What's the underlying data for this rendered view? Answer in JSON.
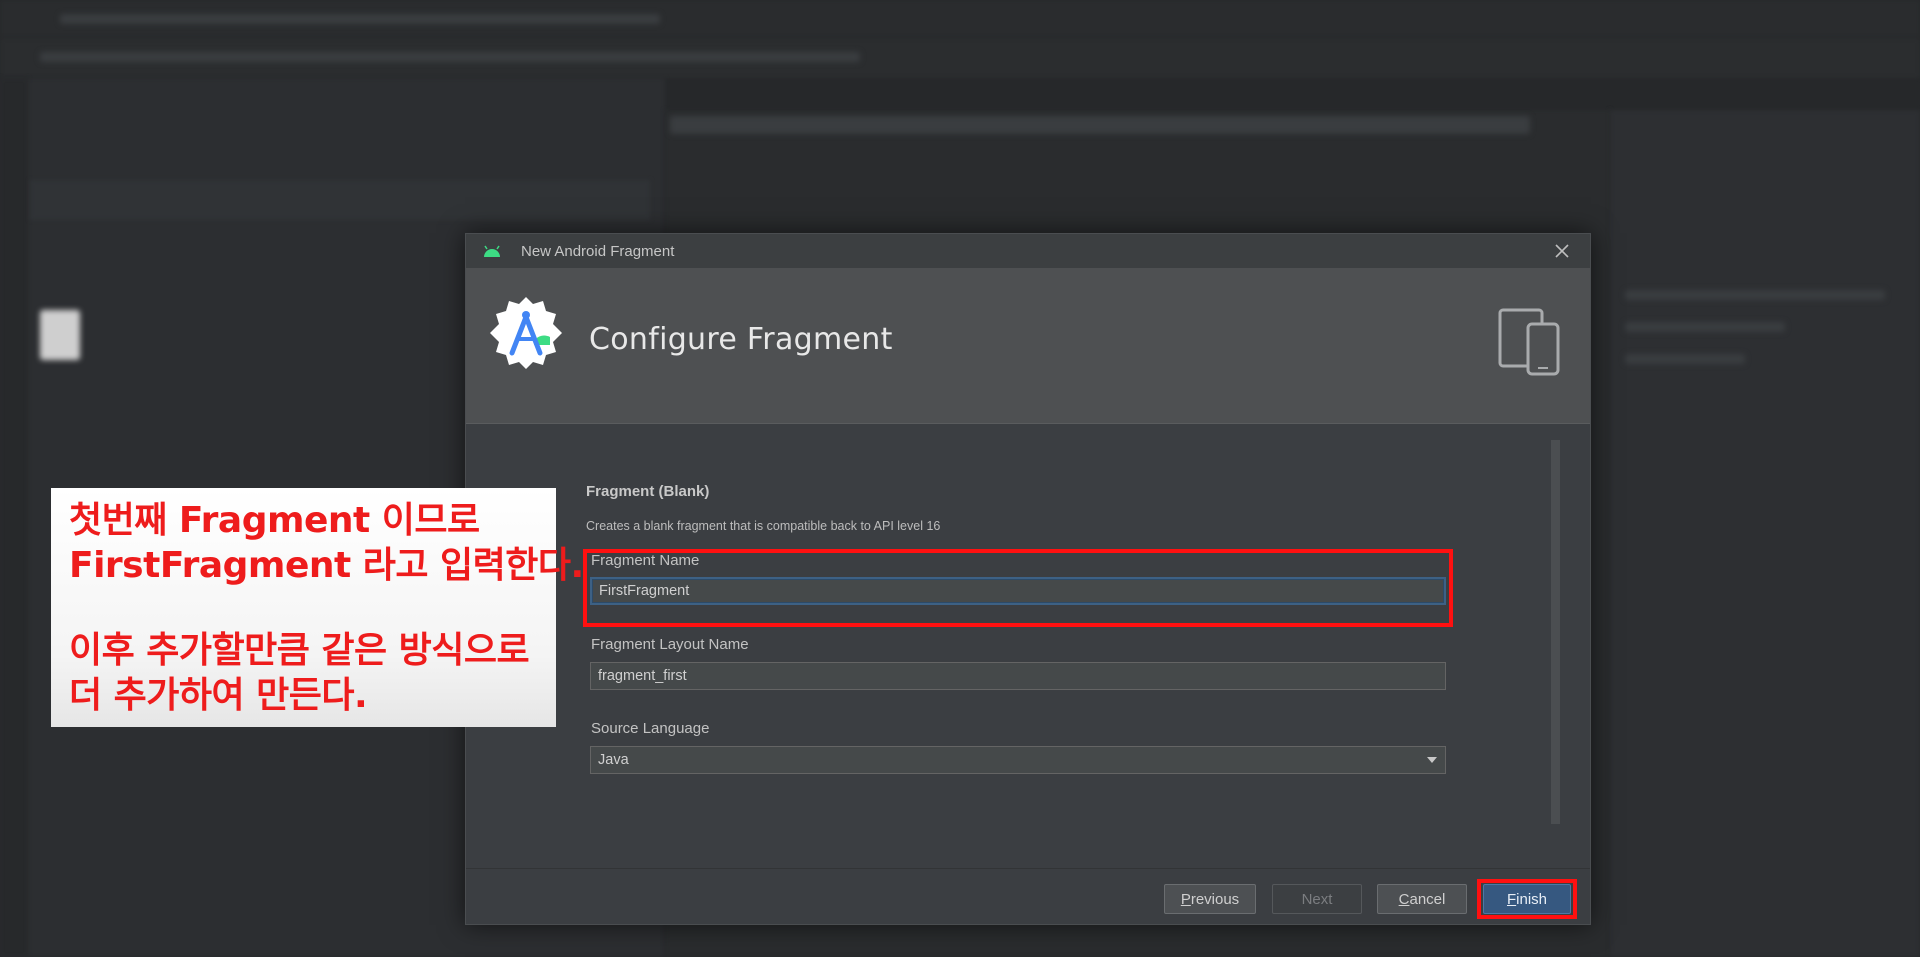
{
  "dialog": {
    "title": "New Android Fragment",
    "header_title": "Configure Fragment",
    "section_title": "Fragment (Blank)",
    "section_description": "Creates a blank fragment that is compatible back to API level 16",
    "fields": {
      "fragment_name": {
        "label": "Fragment Name",
        "value": "FirstFragment"
      },
      "layout_name": {
        "label": "Fragment Layout Name",
        "value": "fragment_first"
      },
      "source_language": {
        "label": "Source Language",
        "value": "Java"
      }
    },
    "buttons": {
      "previous": {
        "mnemonic": "P",
        "rest": "revious"
      },
      "next": {
        "label": "Next"
      },
      "cancel": {
        "mnemonic": "C",
        "rest": "ancel"
      },
      "finish": {
        "mnemonic": "F",
        "rest": "inish"
      }
    }
  },
  "annotation": {
    "line1": "첫번째 Fragment 이므로",
    "line2": "FirstFragment 라고 입력한다.",
    "line3": "이후 추가할만큼 같은 방식으로",
    "line4": "더 추가하여 만든다."
  },
  "colors": {
    "highlight": "#ff1010",
    "annotation_text": "#ee1c1c",
    "primary_button": "#365880",
    "focus_border": "#3d6185"
  },
  "icons": [
    "android-icon",
    "close-icon",
    "android-studio-logo-icon",
    "devices-icon",
    "dropdown-arrow-icon"
  ]
}
